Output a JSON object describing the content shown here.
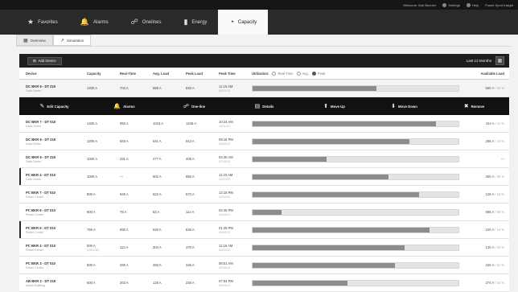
{
  "utility": {
    "welcome": "Welcome, Bob Bonner!",
    "settings": "Settings",
    "help": "Help",
    "app": "Power Sport Insight"
  },
  "nav": [
    {
      "label": "Favorites",
      "icon": "star-icon"
    },
    {
      "label": "Alarms",
      "icon": "bell-icon"
    },
    {
      "label": "Onelines",
      "icon": "oneline-icon"
    },
    {
      "label": "Energy",
      "icon": "energy-bars-icon"
    },
    {
      "label": "Capacity",
      "icon": "capacity-gauge-icon",
      "active": true
    }
  ],
  "subtabs": [
    {
      "label": "Overview",
      "active": true
    },
    {
      "label": "Simulation"
    }
  ],
  "toolbar": {
    "add_device": "Add Device",
    "range": "Last 12 Months"
  },
  "table": {
    "headers": {
      "device": "Device",
      "capacity": "Capacity",
      "realtime": "Real-Time",
      "avg_load": "Avg. Load",
      "peak_load": "Peak Load",
      "peak_time": "Peak Time",
      "utilization": "Utilization:",
      "available": "Available Load"
    },
    "legend": {
      "realtime": "Real-Time",
      "avg": "Avg.",
      "peak": "Peak"
    },
    "rows_before": [
      {
        "name": "DC BKR 6 - DT 010",
        "sub": "Data Center",
        "capacity": "1400 A",
        "capacity_sub": "",
        "realtime": "704 A",
        "avg": "689 A",
        "peak": "840 A",
        "time": "11:15 AM",
        "time_sub": "09/21/13",
        "util": 0.6,
        "avail": "560 A",
        "avail_pct": "/ 40 %",
        "sel": true,
        "flag": false
      }
    ],
    "rows_after": [
      {
        "name": "DC BKR 7 - DT 010",
        "sub": "Data Center",
        "capacity": "1400 A",
        "capacity_sub": "",
        "realtime": "992 A",
        "avg": "1043 A",
        "peak": "1246 A",
        "time": "10:24 AM",
        "time_sub": "10/11/13",
        "util": 0.89,
        "avail": "154 A",
        "avail_pct": "/ 11 %",
        "sel": false,
        "flag": false
      },
      {
        "name": "DC BKR 6 - DT 010",
        "sub": "Data Center",
        "capacity": "1200 A",
        "capacity_sub": "",
        "realtime": "683 A",
        "avg": "641 A",
        "peak": "912 A",
        "time": "09:16 PM",
        "time_sub": "08/22/13",
        "util": 0.76,
        "avail": "288 A",
        "avail_pct": "/ 24 %",
        "sel": false,
        "flag": false
      },
      {
        "name": "DC BKR 5 - DT 010",
        "sub": "Data Center",
        "capacity": "1000 A",
        "capacity_sub": "",
        "realtime": "281 A",
        "avg": "277 A",
        "peak": "405 A",
        "time": "04:26 AM",
        "time_sub": "07/19/13",
        "util": 0.36,
        "avail": "---",
        "avail_pct": "",
        "sel": false,
        "flag": false
      },
      {
        "name": "PC BKR 4 - DT 010",
        "sub": "Data Center",
        "capacity": "1000 A",
        "capacity_sub": "",
        "realtime": "---",
        "avg": "502 A",
        "peak": "650 A",
        "time": "11:43 AM",
        "time_sub": "12/21/13",
        "util": 0.66,
        "avail": "350 A",
        "avail_pct": "/ 35 %",
        "sel": false,
        "flag": true
      },
      {
        "name": "PC BKR 7 - DT 010",
        "sub": "Power Center",
        "capacity": "800 A",
        "capacity_sub": "",
        "realtime": "645 A",
        "avg": "622 A",
        "peak": "672 A",
        "time": "12:15 PM",
        "time_sub": "03/12/13",
        "util": 0.81,
        "avail": "128 A",
        "avail_pct": "/ 16 %",
        "sel": false,
        "flag": false
      },
      {
        "name": "PC BKR 6 - DT 010",
        "sub": "Power Center",
        "capacity": "800 A",
        "capacity_sub": "",
        "realtime": "78 A",
        "avg": "83 A",
        "peak": "112 A",
        "time": "02:45 PM",
        "time_sub": "11/19/13",
        "util": 0.14,
        "avail": "688 A",
        "avail_pct": "/ 86 %",
        "sel": false,
        "flag": false
      },
      {
        "name": "PC BKR 5 - DT 010",
        "sub": "Power Center",
        "capacity": "750 A",
        "capacity_sub": "",
        "realtime": "550 A",
        "avg": "540 A",
        "peak": "645 A",
        "time": "01:28 PM",
        "time_sub": "10/30/13",
        "util": 0.86,
        "avail": "105 A",
        "avail_pct": "/ 14 %",
        "sel": false,
        "flag": true
      },
      {
        "name": "PC BKR 4 - DT 010",
        "sub": "Power Center",
        "capacity": "500 A",
        "capacity_sub": "(200 KW)",
        "realtime": "113 A",
        "avg": "304 A",
        "peak": "370 A",
        "time": "11:16 AM",
        "time_sub": "04/01/13",
        "util": 0.74,
        "avail": "130 A",
        "avail_pct": "/ 26 %",
        "sel": false,
        "flag": false
      },
      {
        "name": "PC BKR 3 - DT 010",
        "sub": "Power Center",
        "capacity": "500 A",
        "capacity_sub": "",
        "realtime": "265 A",
        "avg": "284 A",
        "peak": "345 A",
        "time": "08:51 AM",
        "time_sub": "02/28/13",
        "util": 0.69,
        "avail": "155 A",
        "avail_pct": "/ 31 %",
        "sel": false,
        "flag": false
      },
      {
        "name": "AB BKR 2 - DT 010",
        "sub": "Admin Building",
        "capacity": "500 A",
        "capacity_sub": "",
        "realtime": "203 A",
        "avg": "128 A",
        "peak": "230 A",
        "time": "07:54 PM",
        "time_sub": "09/24/13",
        "util": 0.46,
        "avail": "270 A",
        "avail_pct": "/ 54 %",
        "sel": false,
        "flag": false
      }
    ]
  },
  "actions": [
    {
      "label": "Edit Capacity",
      "icon": "pencil-icon",
      "glyph": "✎"
    },
    {
      "label": "Alarms",
      "icon": "bell-icon",
      "glyph": "🔔"
    },
    {
      "label": "One-line",
      "icon": "oneline-icon",
      "glyph": "☍"
    },
    {
      "label": "Details",
      "icon": "details-icon",
      "glyph": "▤"
    },
    {
      "label": "Move Up",
      "icon": "move-up-icon",
      "glyph": "⬆"
    },
    {
      "label": "Move Down",
      "icon": "move-down-icon",
      "glyph": "⬇"
    },
    {
      "label": "Remove",
      "icon": "remove-icon",
      "glyph": "✖"
    }
  ]
}
